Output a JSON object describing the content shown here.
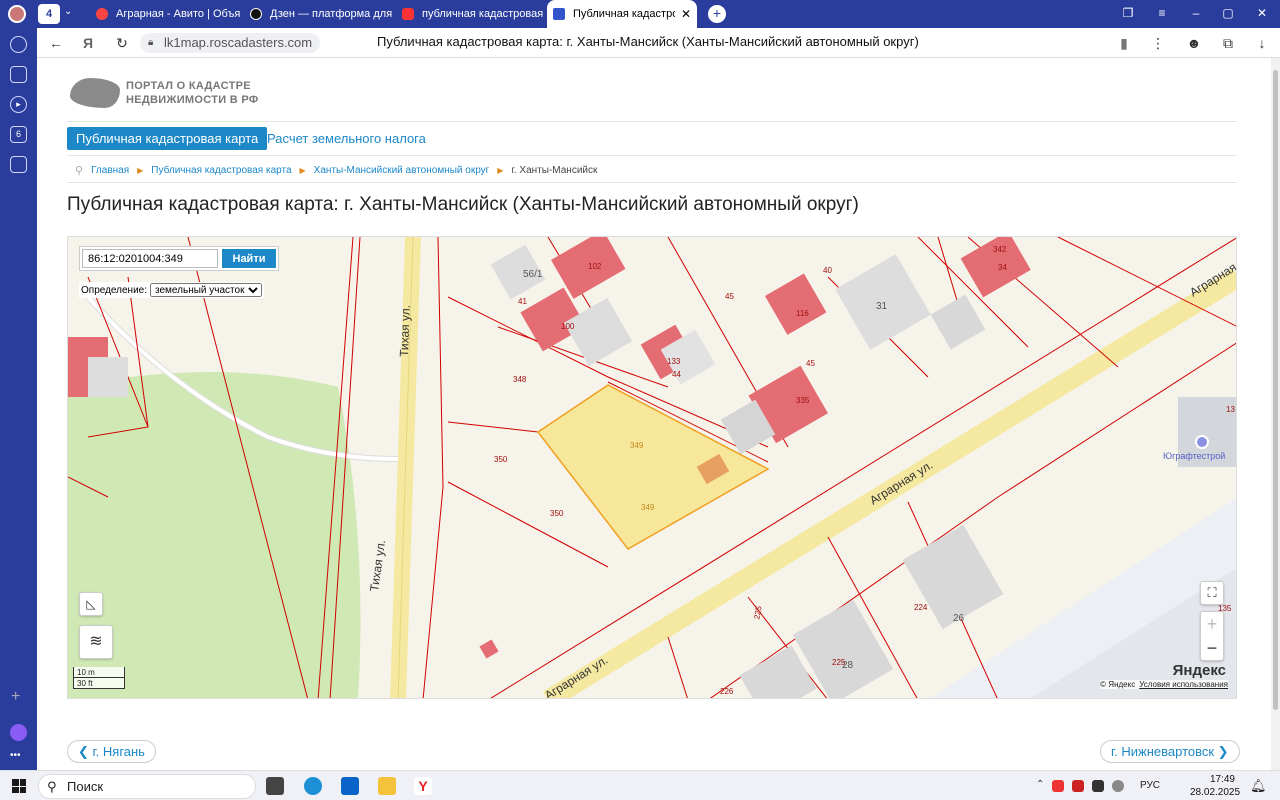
{
  "browser": {
    "tab_count": "4",
    "tabs": [
      {
        "label": "Аграрная - Авито | Объяв",
        "color": "#f44"
      },
      {
        "label": "Дзен — платформа для п",
        "color": "#111"
      },
      {
        "label": "публичная кадастровая к",
        "color": "#f33"
      },
      {
        "label": "Публичная кадастровая карта",
        "color": "#35c"
      }
    ],
    "url": "lk1map.roscadasters.com",
    "page_title": "Публичная кадастровая карта: г. Ханты-Мансийск (Ханты-Мансийский автономный округ)"
  },
  "site": {
    "logo_line1": "ПОРТАЛ О КАДАСТРЕ",
    "logo_line2": "НЕДВИЖИМОСТИ В РФ",
    "nav": [
      "Публичная кадастровая карта",
      "Расчет земельного налога"
    ],
    "breadcrumbs": [
      "Главная",
      "Публичная кадастровая карта",
      "Ханты-Мансийский автономный округ",
      "г. Ханты-Мансийск"
    ],
    "heading": "Публичная кадастровая карта: г. Ханты-Мансийск (Ханты-Мансийский автономный округ)"
  },
  "map": {
    "search_value": "86:12:0201004:349",
    "search_button": "Найти",
    "definition_label": "Определение:",
    "definition_value": "земельный участок",
    "scale_m": "10 m",
    "scale_ft": "30 ft",
    "brand": "Яндекс",
    "copyright": "© Яндекс",
    "terms": "Условия использования",
    "poi": "Юграфтестрой",
    "streets": {
      "tikhaya1": "Тихая ул.",
      "tikhaya2": "Тихая ул.",
      "agrarnaya1": "Аграрная ул.",
      "agrarnaya2": "Аграрная ул.",
      "agrarnaya3": "Аграрная ул."
    },
    "labels": [
      "56/1",
      "102",
      "41",
      "100",
      "45",
      "116",
      "40",
      "31",
      "342",
      "34",
      "133",
      "44",
      "45",
      "335",
      "348",
      "350",
      "350",
      "349",
      "349",
      "26",
      "224",
      "225",
      "28",
      "226",
      "225",
      "135",
      "13"
    ],
    "highlight_color": "#f7e79a"
  },
  "pagination": {
    "prev": "г. Нягань",
    "next": "г. Нижневартовск"
  },
  "taskbar": {
    "search": "Поиск",
    "lang": "РУС",
    "time": "17:49",
    "date": "28.02.2025"
  }
}
